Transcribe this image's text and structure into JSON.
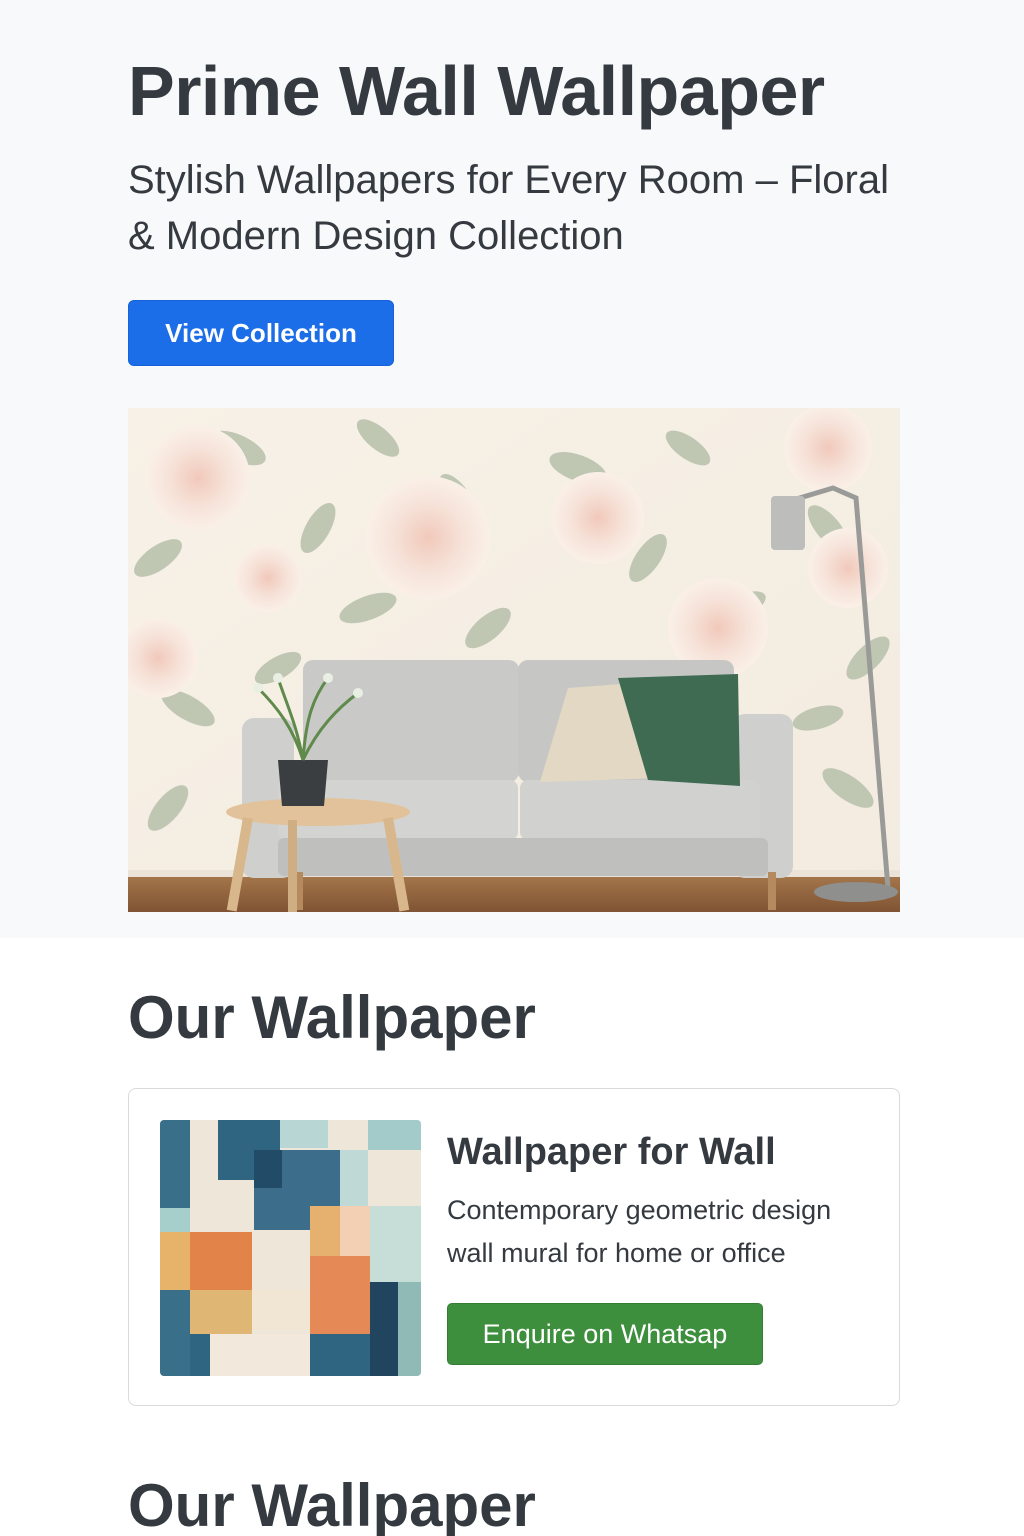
{
  "hero": {
    "title": "Prime Wall Wallpaper",
    "subtitle": "Stylish Wallpapers for Every Room – Floral & Modern Design Collection",
    "button_label": "View Collection",
    "button_color": "#1b6ee8",
    "image_icon": "floral-living-room-photo"
  },
  "sections": [
    {
      "title": "Our Wallpaper",
      "cards": [
        {
          "title": "Wallpaper for Wall",
          "description": "Contemporary geometric design wall mural for home or office",
          "button_label": "Enquire on Whatsap",
          "button_color": "#3d8f3d",
          "image_icon": "geometric-wallpaper-thumbnail"
        }
      ]
    },
    {
      "title": "Our Wallpaper"
    }
  ]
}
